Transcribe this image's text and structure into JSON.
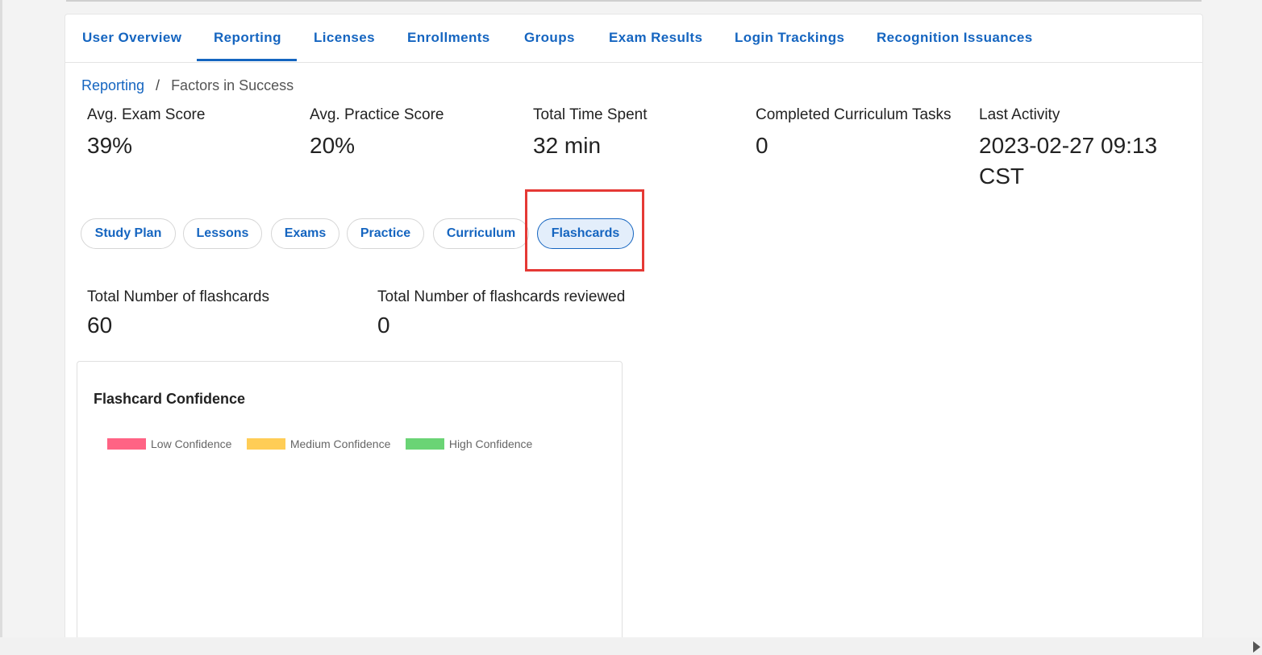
{
  "tabs": [
    {
      "label": "User Overview"
    },
    {
      "label": "Reporting"
    },
    {
      "label": "Licenses"
    },
    {
      "label": "Enrollments"
    },
    {
      "label": "Groups"
    },
    {
      "label": "Exam Results"
    },
    {
      "label": "Login Trackings"
    },
    {
      "label": "Recognition Issuances"
    }
  ],
  "active_tab": "Reporting",
  "breadcrumb": {
    "parent": "Reporting",
    "separator": "/",
    "current": "Factors in Success"
  },
  "stats": [
    {
      "label": "Avg. Exam Score",
      "value": "39%"
    },
    {
      "label": "Avg. Practice Score",
      "value": "20%"
    },
    {
      "label": "Total Time Spent",
      "value": "32 min"
    },
    {
      "label": "Completed Curriculum Tasks",
      "value": "0"
    },
    {
      "label": "Last Activity",
      "value_line1": "2023-02-27 09:13",
      "value_line2": "CST"
    }
  ],
  "filters": [
    {
      "label": "Study Plan"
    },
    {
      "label": "Lessons"
    },
    {
      "label": "Exams"
    },
    {
      "label": "Practice"
    },
    {
      "label": "Curriculum"
    },
    {
      "label": "Flashcards"
    }
  ],
  "active_filter": "Flashcards",
  "flashcard_stats": [
    {
      "label": "Total Number of flashcards",
      "value": "60"
    },
    {
      "label": "Total Number of flashcards reviewed",
      "value": "0"
    }
  ],
  "chart": {
    "title": "Flashcard Confidence",
    "legend": [
      {
        "label": "Low Confidence",
        "color": "#ff6384"
      },
      {
        "label": "Medium Confidence",
        "color": "#ffcd56"
      },
      {
        "label": "High Confidence",
        "color": "#6ad475"
      }
    ]
  },
  "colors": {
    "accent": "#1565c0",
    "highlight": "#e53935"
  }
}
